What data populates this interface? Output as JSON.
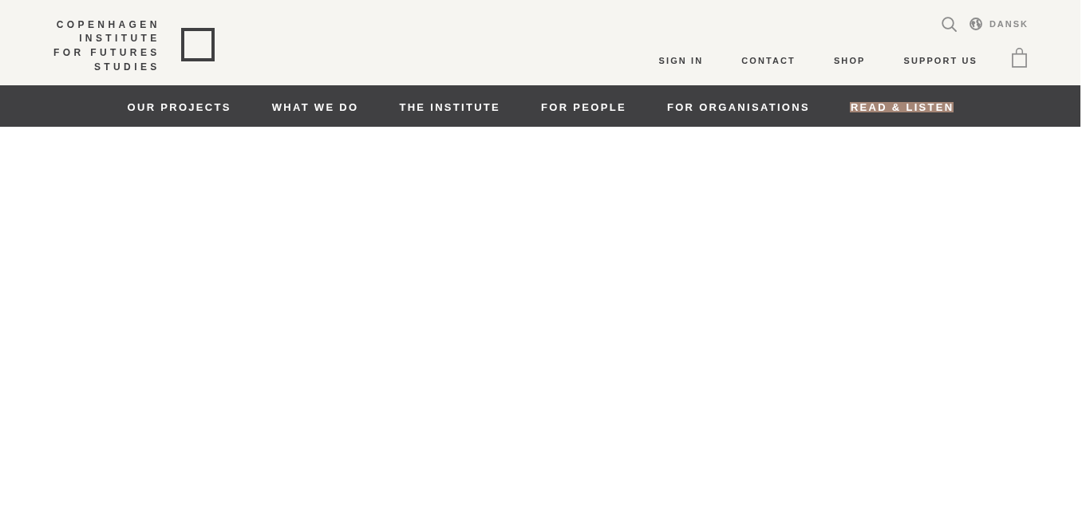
{
  "logo": {
    "lines": [
      "COPENHAGEN",
      "INSTITUTE",
      "FOR FUTURES",
      "STUDIES"
    ]
  },
  "utility": {
    "language": "DANSK"
  },
  "top_links": [
    {
      "label": "SIGN IN"
    },
    {
      "label": "CONTACT"
    },
    {
      "label": "SHOP"
    },
    {
      "label": "SUPPORT US"
    }
  ],
  "nav": [
    {
      "label": "OUR PROJECTS",
      "selected": false
    },
    {
      "label": "WHAT WE DO",
      "selected": false
    },
    {
      "label": "THE INSTITUTE",
      "selected": false
    },
    {
      "label": "FOR PEOPLE",
      "selected": false
    },
    {
      "label": "FOR ORGANISATIONS",
      "selected": false
    },
    {
      "label": "READ & LISTEN",
      "selected": true
    }
  ]
}
